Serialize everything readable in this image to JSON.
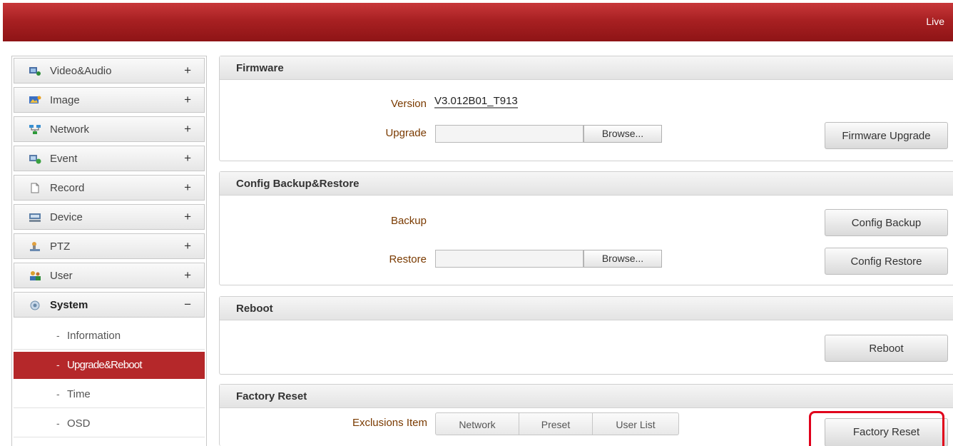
{
  "header": {
    "live_label": "Live"
  },
  "sidebar": {
    "items": [
      {
        "label": "Video&Audio",
        "sign": "+",
        "icon": "video-audio-icon"
      },
      {
        "label": "Image",
        "sign": "+",
        "icon": "image-icon"
      },
      {
        "label": "Network",
        "sign": "+",
        "icon": "network-icon"
      },
      {
        "label": "Event",
        "sign": "+",
        "icon": "event-icon"
      },
      {
        "label": "Record",
        "sign": "+",
        "icon": "record-icon"
      },
      {
        "label": "Device",
        "sign": "+",
        "icon": "device-icon"
      },
      {
        "label": "PTZ",
        "sign": "+",
        "icon": "ptz-icon"
      },
      {
        "label": "User",
        "sign": "+",
        "icon": "user-icon"
      },
      {
        "label": "System",
        "sign": "−",
        "icon": "system-icon"
      }
    ],
    "sub_items": [
      {
        "label": "Information",
        "active": false
      },
      {
        "label": "Upgrade&Reboot",
        "active": true
      },
      {
        "label": "Time",
        "active": false
      },
      {
        "label": "OSD",
        "active": false
      }
    ],
    "bullet": "-"
  },
  "firmware": {
    "title": "Firmware",
    "version_label": "Version",
    "version_value": "V3.012B01_T913",
    "upgrade_label": "Upgrade",
    "browse_label": "Browse...",
    "upgrade_button": "Firmware Upgrade"
  },
  "config": {
    "title": "Config Backup&Restore",
    "backup_label": "Backup",
    "restore_label": "Restore",
    "browse_label": "Browse...",
    "backup_button": "Config Backup",
    "restore_button": "Config Restore"
  },
  "reboot": {
    "title": "Reboot",
    "reboot_button": "Reboot"
  },
  "factory": {
    "title": "Factory Reset",
    "exclusions_label": "Exclusions Item",
    "exclusions": [
      "Network",
      "Preset",
      "User List"
    ],
    "reset_button": "Factory Reset"
  },
  "colors": {
    "accent": "#b5282a",
    "highlight": "#e0001b"
  }
}
